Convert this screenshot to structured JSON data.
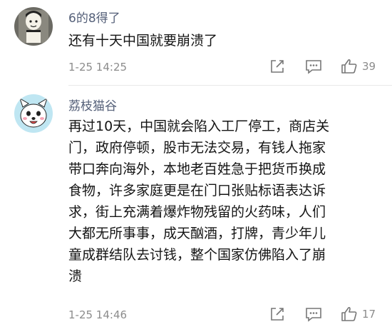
{
  "comments": [
    {
      "author": "6的8得了",
      "text": "还有十天中国就要崩溃了",
      "time": "1-25 14:25",
      "likes": "39",
      "avatar_icon": "cartoon-boy-avatar"
    },
    {
      "author": "荔枝猫谷",
      "lines": [
        "再过10天，中国就会陷入工厂停工，商店关",
        "门，政府停顿，股市无法交易，有钱人拖家",
        "带口奔向海外，本地老百姓急于把货币换成",
        "食物，许多家庭更是在门口张贴标语表达诉",
        "求，街上充满着爆炸物残留的火药味，人们",
        "大都无所事事，成天酗酒，打牌，青少年儿",
        "童成群结队去讨钱，整个国家仿佛陷入了崩",
        "溃"
      ],
      "time": "1-25 14:46",
      "likes": "17",
      "avatar_icon": "white-dog-avatar"
    }
  ],
  "colors": {
    "author": "#556079",
    "meta": "#8c8c8c",
    "text": "#141414"
  }
}
